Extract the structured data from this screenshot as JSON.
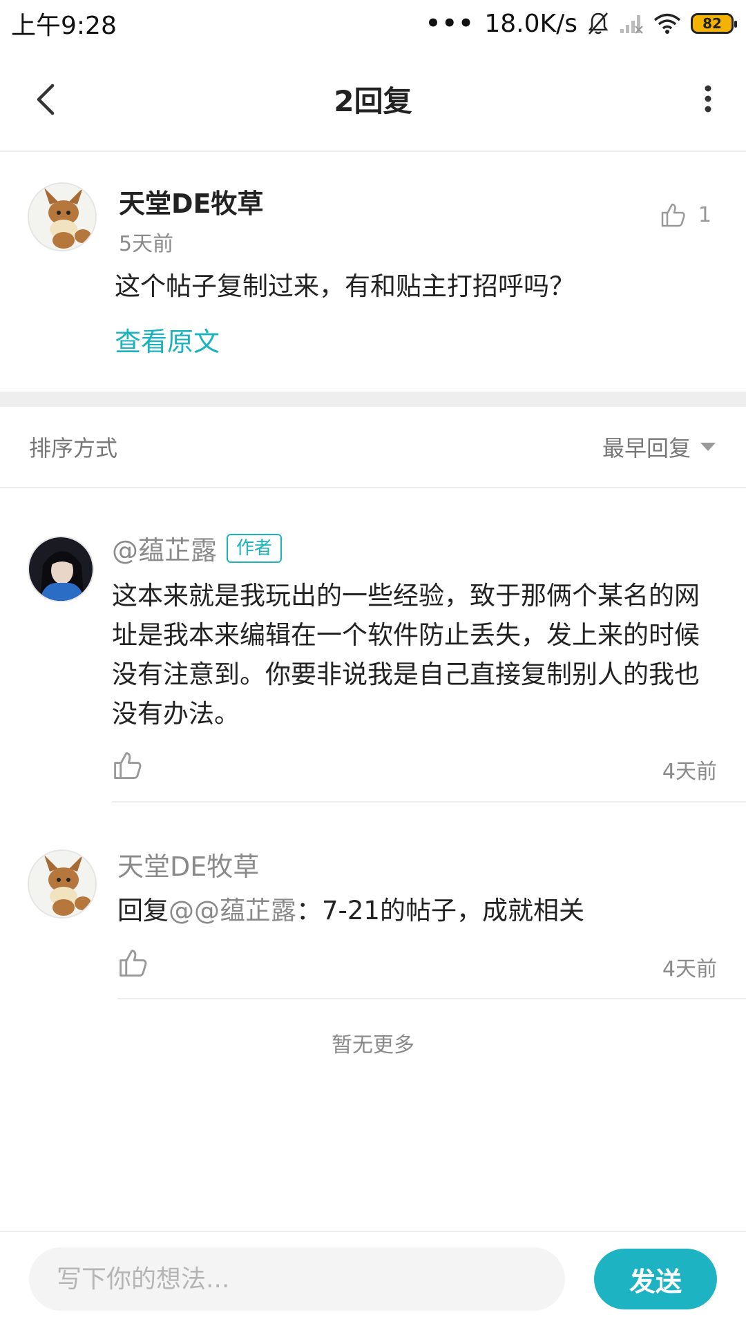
{
  "status_bar": {
    "time": "上午9:28",
    "dots": "•••",
    "net_speed": "18.0K/s",
    "battery_level": "82",
    "icons": [
      "bell-mute-icon",
      "signal-icon",
      "wifi-icon",
      "battery-icon"
    ]
  },
  "header": {
    "title": "2回复",
    "back_icon": "chevron-left-icon",
    "more_icon": "more-vertical-icon"
  },
  "post": {
    "author": "天堂DE牧草",
    "time": "5天前",
    "like_count": "1",
    "text": "这个帖子复制过来，有和贴主打招呼吗？",
    "view_original": "查看原文"
  },
  "sort": {
    "label": "排序方式",
    "selected": "最早回复"
  },
  "replies": [
    {
      "author": "@蕴芷露",
      "badge": "作者",
      "text": "这本来就是我玩出的一些经验，致于那俩个某名的网址是我本来编辑在一个软件防止丢失，发上来的时候没有注意到。你要非说我是自己直接复制别人的我也没有办法。",
      "time": "4天前"
    },
    {
      "author": "天堂DE牧草",
      "reply_prefix": "回复",
      "mention": "@@蕴芷露",
      "text": "：7-21的帖子，成就相关",
      "time": "4天前"
    }
  ],
  "footer_note": "暂无更多",
  "composer": {
    "placeholder": "写下你的想法...",
    "value": "",
    "send_label": "发送"
  },
  "colors": {
    "accent": "#19b3bf",
    "send_button": "#1eb3c2",
    "battery": "#f3b300"
  }
}
